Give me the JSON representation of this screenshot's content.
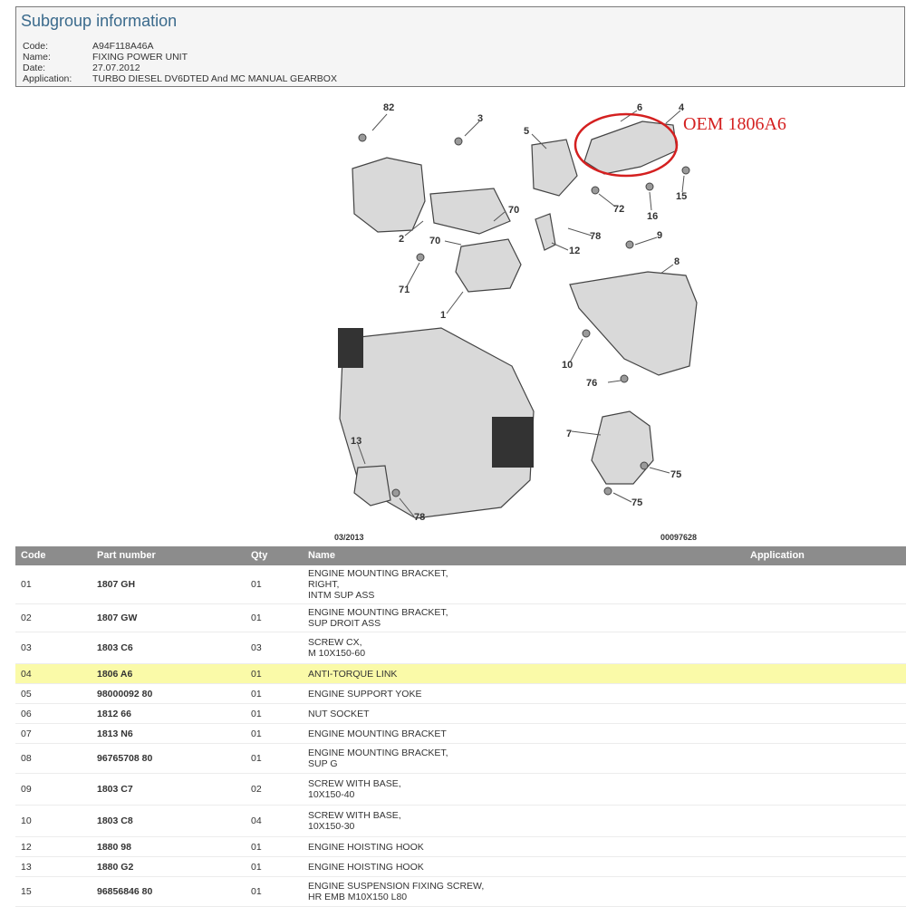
{
  "subgroup": {
    "title": "Subgroup information",
    "fields": [
      {
        "label": "Code:",
        "value": "A94F118A46A"
      },
      {
        "label": "Name:",
        "value": "FIXING POWER UNIT"
      },
      {
        "label": "Date:",
        "value": "27.07.2012"
      },
      {
        "label": "Application:",
        "value": "TURBO DIESEL DV6DTED And MC MANUAL GEARBOX"
      }
    ]
  },
  "diagram": {
    "callout": "OEM 1806A6",
    "date_code": "03/2013",
    "ref_code": "00097628",
    "callout_color": "#d42020",
    "labels": [
      "82",
      "3",
      "6",
      "4",
      "5",
      "15",
      "72",
      "16",
      "2",
      "70",
      "70",
      "78",
      "12",
      "9",
      "71",
      "8",
      "1",
      "10",
      "76",
      "7",
      "75",
      "75",
      "13",
      "78"
    ]
  },
  "table": {
    "headers": [
      "Code",
      "Part number",
      "Qty",
      "Name",
      "Application"
    ],
    "highlight_color": "#fafaa8",
    "rows": [
      {
        "code": "01",
        "part": "1807 GH",
        "qty": "01",
        "name": "ENGINE MOUNTING BRACKET,\nRIGHT,\nINTM SUP ASS"
      },
      {
        "code": "02",
        "part": "1807 GW",
        "qty": "01",
        "name": "ENGINE MOUNTING BRACKET,\nSUP DROIT ASS"
      },
      {
        "code": "03",
        "part": "1803 C6",
        "qty": "03",
        "name": "SCREW CX,\nM 10X150-60"
      },
      {
        "code": "04",
        "part": "1806 A6",
        "qty": "01",
        "name": "ANTI-TORQUE LINK"
      },
      {
        "code": "05",
        "part": "98000092 80",
        "qty": "01",
        "name": "ENGINE SUPPORT YOKE"
      },
      {
        "code": "06",
        "part": "1812 66",
        "qty": "01",
        "name": "NUT SOCKET"
      },
      {
        "code": "07",
        "part": "1813 N6",
        "qty": "01",
        "name": "ENGINE MOUNTING BRACKET"
      },
      {
        "code": "08",
        "part": "96765708 80",
        "qty": "01",
        "name": "ENGINE MOUNTING BRACKET,\nSUP G"
      },
      {
        "code": "09",
        "part": "1803 C7",
        "qty": "02",
        "name": "SCREW WITH BASE,\n10X150-40"
      },
      {
        "code": "10",
        "part": "1803 C8",
        "qty": "04",
        "name": "SCREW WITH BASE,\n10X150-30"
      },
      {
        "code": "12",
        "part": "1880 98",
        "qty": "01",
        "name": "ENGINE HOISTING HOOK"
      },
      {
        "code": "13",
        "part": "1880 G2",
        "qty": "01",
        "name": "ENGINE HOISTING HOOK"
      },
      {
        "code": "15",
        "part": "96856846 80",
        "qty": "01",
        "name": "ENGINE SUSPENSION FIXING SCREW,\nHR EMB M10X150 L80"
      }
    ]
  }
}
